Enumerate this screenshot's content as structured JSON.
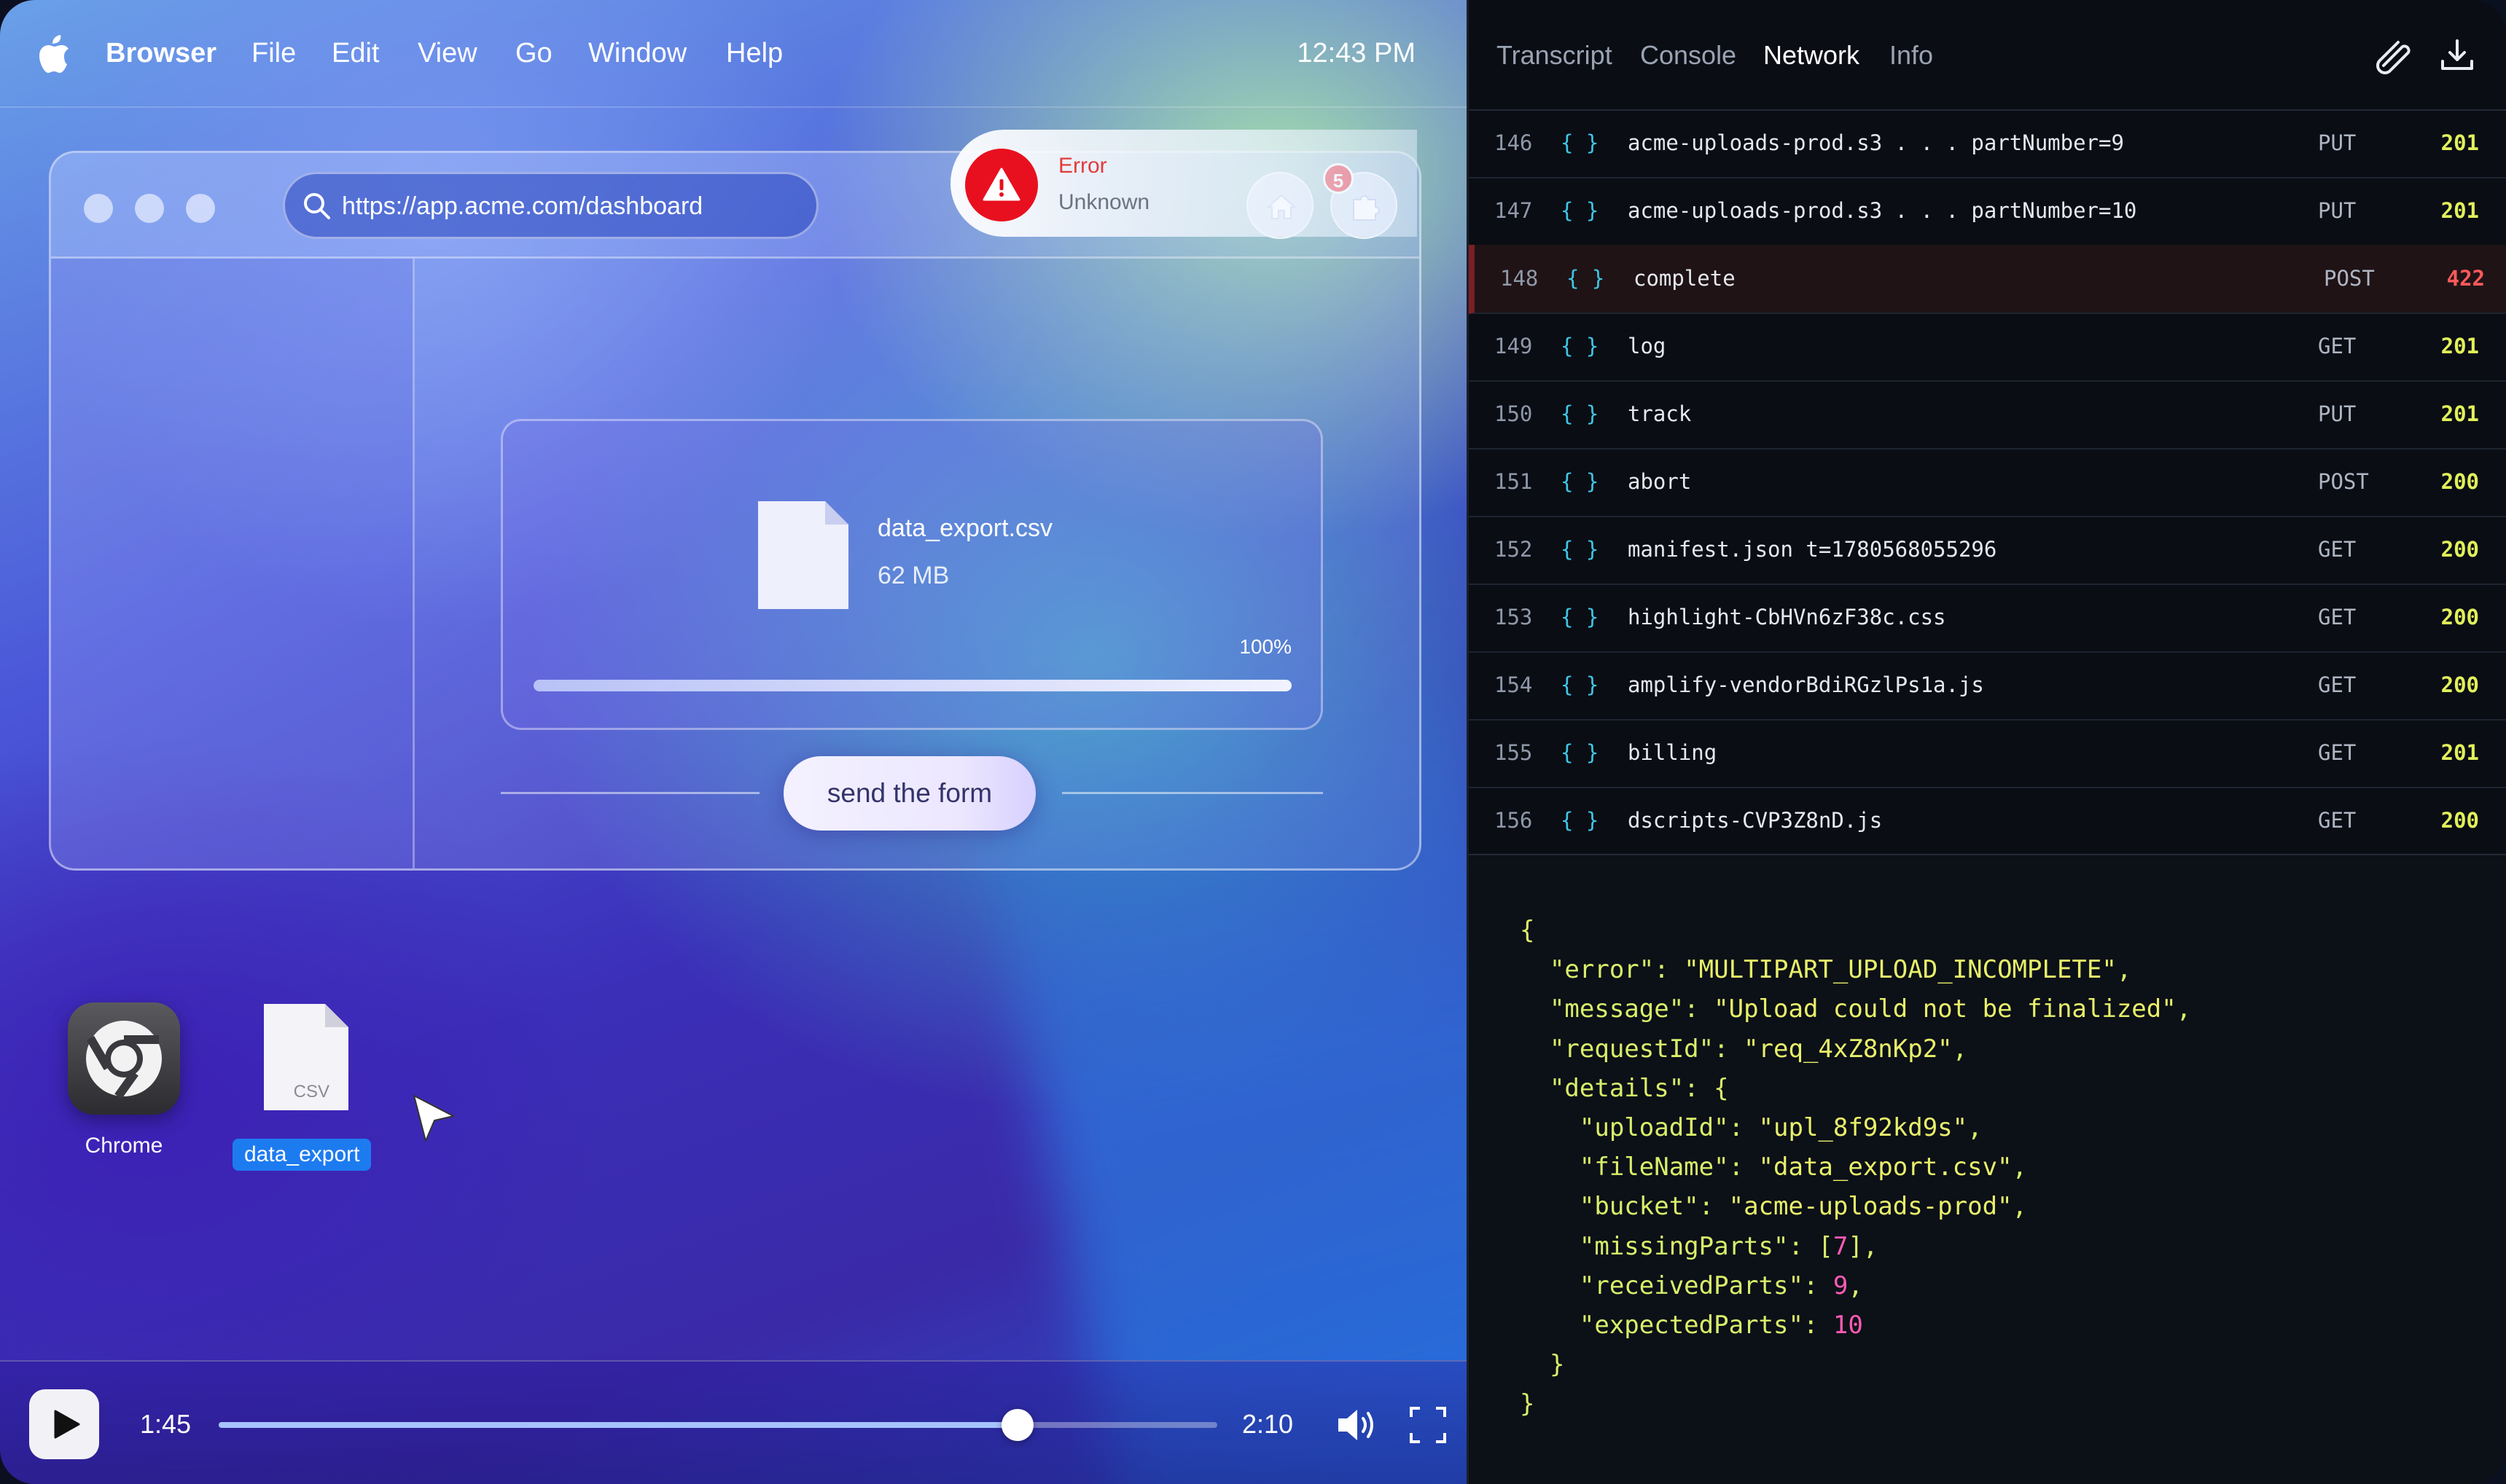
{
  "menubar": {
    "app_name": "Browser",
    "items": [
      "File",
      "Edit",
      "View",
      "Go",
      "Window",
      "Help"
    ],
    "clock": "12:43 PM"
  },
  "browser": {
    "url": "https://app.acme.com/dashboard",
    "notification_count": "5",
    "toast": {
      "title": "Error",
      "message": "Unknown",
      "icon": "warning-icon",
      "color": "#e8101e"
    },
    "file": {
      "name": "data_export.csv",
      "size": "62 MB",
      "progress_label": "100%",
      "progress": 1.0
    },
    "send_button": "send the form"
  },
  "desktop": {
    "icons": [
      {
        "label": "Chrome",
        "icon": "chrome-icon"
      },
      {
        "label": "data_export",
        "icon": "csv-file-icon",
        "badge": "CSV",
        "selected": true
      }
    ]
  },
  "player": {
    "current_time": "1:45",
    "duration": "2:10",
    "progress": 0.8
  },
  "devtools": {
    "tabs": [
      "Transcript",
      "Console",
      "Network",
      "Info"
    ],
    "active_tab": "Network",
    "rows": [
      {
        "num": "146",
        "name": "acme-uploads-prod.s3 . . . partNumber=9",
        "method": "PUT",
        "status": "201",
        "error": false
      },
      {
        "num": "147",
        "name": "acme-uploads-prod.s3 . . . partNumber=10",
        "method": "PUT",
        "status": "201",
        "error": false
      },
      {
        "num": "148",
        "name": "complete",
        "method": "POST",
        "status": "422",
        "error": true
      },
      {
        "num": "149",
        "name": "log",
        "method": "GET",
        "status": "201",
        "error": false
      },
      {
        "num": "150",
        "name": "track",
        "method": "PUT",
        "status": "201",
        "error": false
      },
      {
        "num": "151",
        "name": "abort",
        "method": "POST",
        "status": "200",
        "error": false
      },
      {
        "num": "152",
        "name": "manifest.json t=1780568055296",
        "method": "GET",
        "status": "200",
        "error": false
      },
      {
        "num": "153",
        "name": "highlight-CbHVn6zF38c.css",
        "method": "GET",
        "status": "200",
        "error": false
      },
      {
        "num": "154",
        "name": "amplify-vendorBdiRGzlPs1a.js",
        "method": "GET",
        "status": "200",
        "error": false
      },
      {
        "num": "155",
        "name": "billing",
        "method": "GET",
        "status": "201",
        "error": false
      },
      {
        "num": "156",
        "name": "dscripts-CVP3Z8nD.js",
        "method": "GET",
        "status": "200",
        "error": false
      }
    ],
    "response_lines": [
      [
        [
          "p",
          "{"
        ]
      ],
      [
        [
          "p",
          "  "
        ],
        [
          "k",
          "\"error\""
        ],
        [
          "p",
          ": "
        ],
        [
          "s",
          "\"MULTIPART_UPLOAD_INCOMPLETE\""
        ],
        [
          "p",
          ","
        ]
      ],
      [
        [
          "p",
          "  "
        ],
        [
          "k",
          "\"message\""
        ],
        [
          "p",
          ": "
        ],
        [
          "s",
          "\"Upload could not be finalized\""
        ],
        [
          "p",
          ","
        ]
      ],
      [
        [
          "p",
          "  "
        ],
        [
          "k",
          "\"requestId\""
        ],
        [
          "p",
          ": "
        ],
        [
          "s",
          "\"req_4xZ8nKp2\""
        ],
        [
          "p",
          ","
        ]
      ],
      [
        [
          "p",
          "  "
        ],
        [
          "k",
          "\"details\""
        ],
        [
          "p",
          ": {"
        ]
      ],
      [
        [
          "p",
          "    "
        ],
        [
          "k",
          "\"uploadId\""
        ],
        [
          "p",
          ": "
        ],
        [
          "s",
          "\"upl_8f92kd9s\""
        ],
        [
          "p",
          ","
        ]
      ],
      [
        [
          "p",
          "    "
        ],
        [
          "k",
          "\"fileName\""
        ],
        [
          "p",
          ": "
        ],
        [
          "s",
          "\"data_export.csv\""
        ],
        [
          "p",
          ","
        ]
      ],
      [
        [
          "p",
          "    "
        ],
        [
          "k",
          "\"bucket\""
        ],
        [
          "p",
          ": "
        ],
        [
          "s",
          "\"acme-uploads-prod\""
        ],
        [
          "p",
          ","
        ]
      ],
      [
        [
          "p",
          "    "
        ],
        [
          "k",
          "\"missingParts\""
        ],
        [
          "p",
          ": ["
        ],
        [
          "n",
          "7"
        ],
        [
          "p",
          "],"
        ]
      ],
      [
        [
          "p",
          "    "
        ],
        [
          "k",
          "\"receivedParts\""
        ],
        [
          "p",
          ": "
        ],
        [
          "n",
          "9"
        ],
        [
          "p",
          ","
        ]
      ],
      [
        [
          "p",
          "    "
        ],
        [
          "k",
          "\"expectedParts\""
        ],
        [
          "p",
          ": "
        ],
        [
          "n",
          "10"
        ]
      ],
      [
        [
          "p",
          "  }"
        ]
      ],
      [
        [
          "p",
          "}"
        ]
      ]
    ]
  }
}
